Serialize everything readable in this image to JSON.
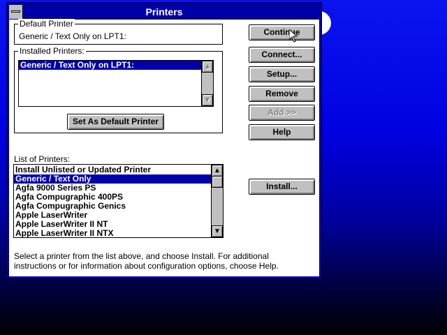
{
  "window": {
    "title": "Printers"
  },
  "default_printer": {
    "label": "Default Printer",
    "value": "Generic / Text Only on LPT1:"
  },
  "installed": {
    "label": "Installed Printers:",
    "items": [
      "Generic / Text Only on LPT1:"
    ],
    "set_default": "Set As Default Printer"
  },
  "buttons": {
    "continue": "Continue",
    "connect": "Connect...",
    "setup": "Setup...",
    "remove": "Remove",
    "add": "Add >>",
    "help": "Help",
    "install": "Install..."
  },
  "list_of_printers": {
    "label": "List of Printers:",
    "items": [
      "Install Unlisted or Updated Printer",
      "Generic / Text Only",
      "Agfa 9000 Series PS",
      "Agfa Compugraphic 400PS",
      "Agfa Compugraphic Genics",
      "Apple LaserWriter",
      "Apple LaserWriter II NT",
      "Apple LaserWriter II NTX"
    ],
    "selected": 1
  },
  "help_text": [
    "Select a printer from the list above, and choose Install. For additional",
    "instructions or for information about configuration options, choose Help."
  ]
}
